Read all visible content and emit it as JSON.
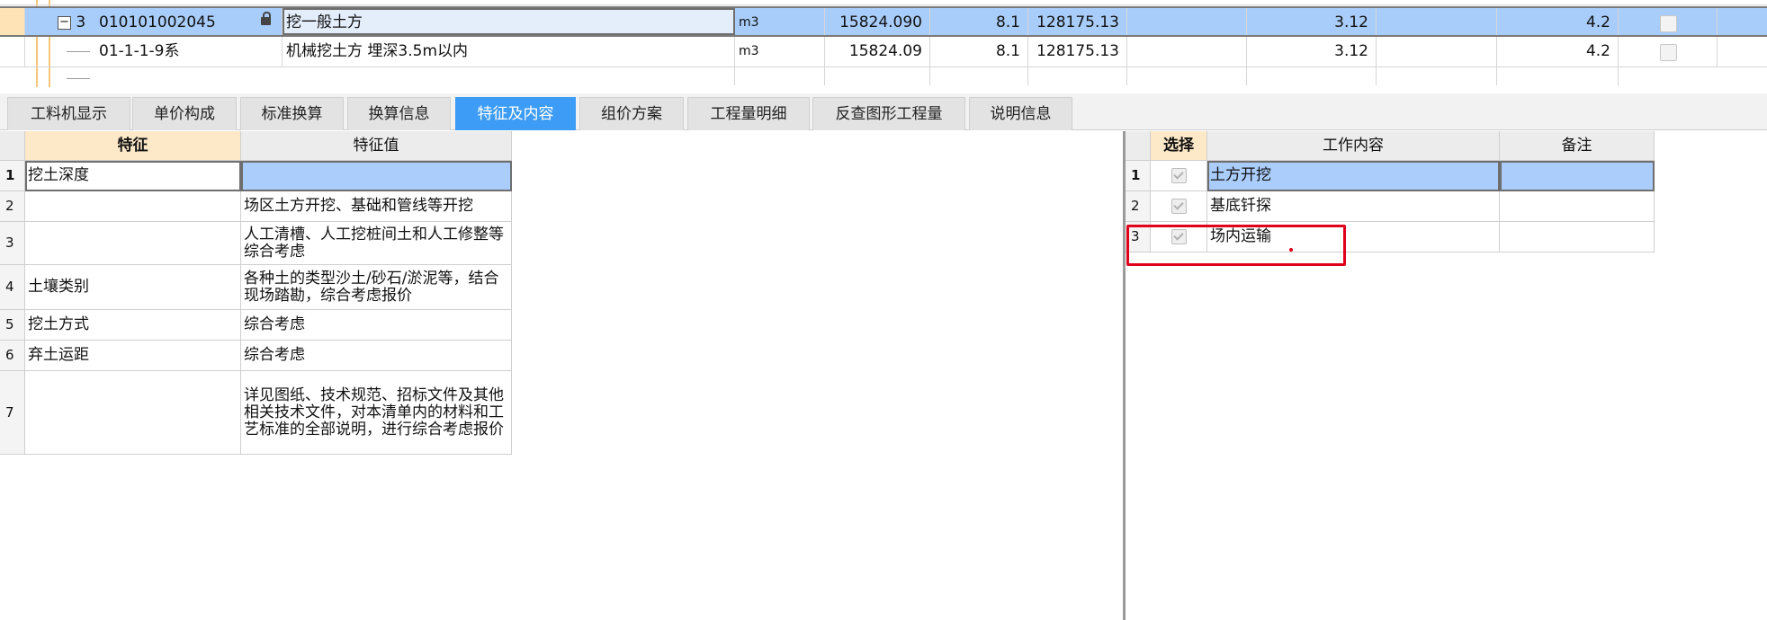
{
  "top_rows": [
    {
      "level": "3",
      "code": "010101002045",
      "name": "挖一般土方",
      "unit": "m3",
      "quantity": "15824.090",
      "price": "8.1",
      "total": "128175.13",
      "v1": "3.12",
      "v2": "4.2"
    },
    {
      "code": "01-1-1-9系",
      "name": "机械挖土方 埋深3.5m以内",
      "unit": "m3",
      "quantity": "15824.09",
      "price": "8.1",
      "total": "128175.13",
      "v1": "3.12",
      "v2": "4.2"
    }
  ],
  "tabs": [
    "工料机显示",
    "单价构成",
    "标准换算",
    "换算信息",
    "特征及内容",
    "组价方案",
    "工程量明细",
    "反查图形工程量",
    "说明信息"
  ],
  "active_tab": "特征及内容",
  "features": {
    "headers": {
      "feature": "特征",
      "value": "特征值"
    },
    "rows": [
      {
        "n": "1",
        "feature": "挖土深度",
        "value": ""
      },
      {
        "n": "2",
        "feature": "",
        "value": "场区土方开挖、基础和管线等开挖"
      },
      {
        "n": "3",
        "feature": "",
        "value": "人工清槽、人工挖桩间土和人工修整等综合考虑"
      },
      {
        "n": "4",
        "feature": "土壤类别",
        "value": "各种土的类型沙土/砂石/淤泥等，结合现场踏勘，综合考虑报价"
      },
      {
        "n": "5",
        "feature": "挖土方式",
        "value": "综合考虑"
      },
      {
        "n": "6",
        "feature": "弃土运距",
        "value": "综合考虑"
      },
      {
        "n": "7",
        "feature": "",
        "value": "详见图纸、技术规范、招标文件及其他相关技术文件，对本清单内的材料和工艺标准的全部说明，进行综合考虑报价"
      }
    ]
  },
  "work": {
    "headers": {
      "select": "选择",
      "content": "工作内容",
      "remark": "备注"
    },
    "rows": [
      {
        "n": "1",
        "content": "土方开挖",
        "remark": ""
      },
      {
        "n": "2",
        "content": "基底钎探",
        "remark": ""
      },
      {
        "n": "3",
        "content": "场内运输",
        "remark": ""
      }
    ]
  },
  "colors": {
    "active_tab": "#3d9cf5",
    "selected_row": "#a9cdfb",
    "highlight_box": "#e0001b"
  }
}
